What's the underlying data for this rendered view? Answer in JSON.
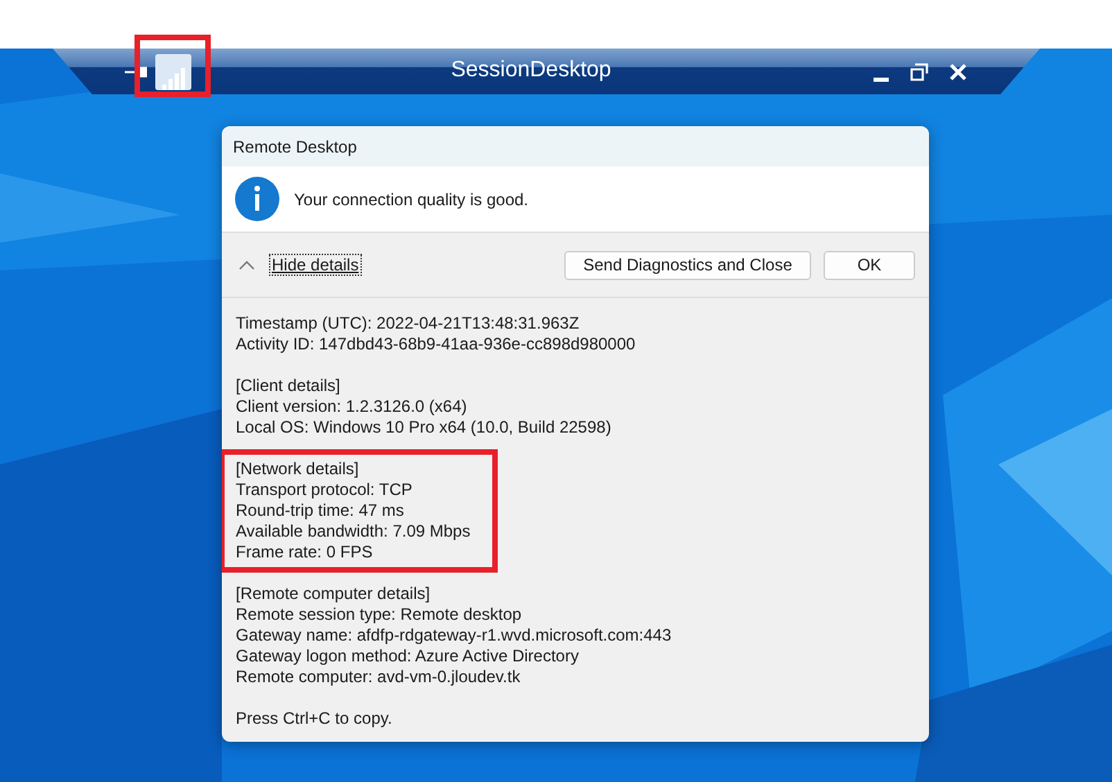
{
  "connection_bar": {
    "title": "SessionDesktop",
    "signal_highlighted": true
  },
  "dialog": {
    "title": "Remote Desktop",
    "message": "Your connection quality is good.",
    "toggle": {
      "label": "Hide details",
      "expanded": true
    },
    "buttons": [
      "Send Diagnostics and Close",
      "OK"
    ],
    "details": [
      {
        "highlighted": false,
        "lines": [
          "Timestamp (UTC): 2022-04-21T13:48:31.963Z",
          "Activity ID: 147dbd43-68b9-41aa-936e-cc898d980000"
        ]
      },
      {
        "highlighted": false,
        "lines": [
          "[Client details]",
          "Client version: 1.2.3126.0 (x64)",
          "Local OS: Windows 10 Pro x64 (10.0, Build 22598)"
        ]
      },
      {
        "highlighted": true,
        "lines": [
          "[Network details]",
          "Transport protocol: TCP",
          "Round-trip time: 47 ms",
          "Available bandwidth: 7.09 Mbps",
          "Frame rate: 0 FPS"
        ]
      },
      {
        "highlighted": false,
        "lines": [
          "[Remote computer details]",
          "Remote session type: Remote desktop",
          "Gateway name: afdfp-rdgateway-r1.wvd.microsoft.com:443",
          "Gateway logon method: Azure Active Directory",
          "Remote computer: avd-vm-0.jloudev.tk"
        ]
      },
      {
        "highlighted": false,
        "lines": [
          "Press Ctrl+C to copy."
        ]
      }
    ]
  }
}
